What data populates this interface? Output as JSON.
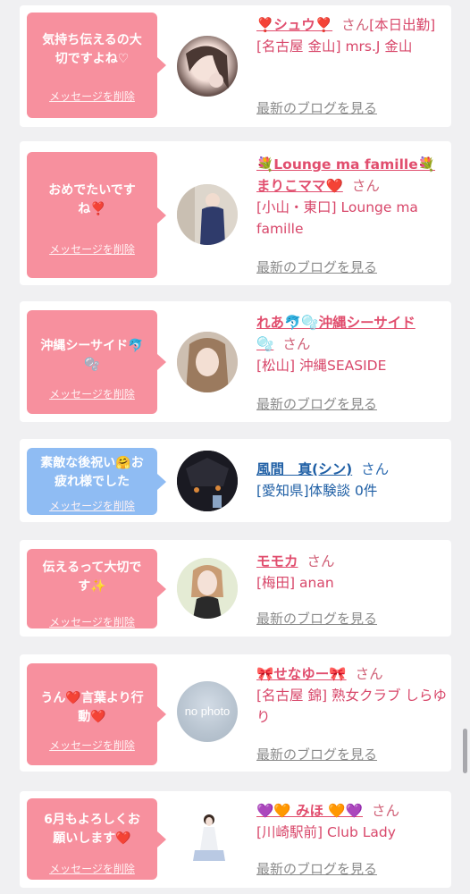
{
  "delete_label": "メッセージを削除",
  "blog_label": "最新のブログを見る",
  "honorific": "さん",
  "cards": [
    {
      "message": "気持ち伝えるの大\n切ですよね♡",
      "name": "❣️シュウ❣️",
      "name_tail": "",
      "badge": "[本日出勤]",
      "tag": "[名古屋 金山] mrs.J 金山"
    },
    {
      "message": "おめでたいです\nね❣️",
      "name": "💐Lounge ma famille💐",
      "name_tail": "まりこママ❤️",
      "tag": "[小山・東口] Lounge ma famille"
    },
    {
      "message": "沖縄シーサイド🐬\n🫧",
      "name": "れあ🐬🫧沖縄シーサイド",
      "name_tail": "🫧",
      "tag": "[松山] 沖縄SEASIDE"
    },
    {
      "message": "素敵な後祝い🤗お\n疲れ様でした",
      "name": "風間　真(シン)",
      "tag": "[愛知県]体験談 0件"
    },
    {
      "message": "伝えるって大切で\nす✨",
      "name": "モモカ",
      "tag": "[梅田] anan"
    },
    {
      "message": "うん❤️言葉より行\n動❤️",
      "name": "🎀せなゆー🎀",
      "tag": "[名古屋 錦] 熟女クラブ しらゆり",
      "avatar_text": "no photo"
    },
    {
      "message": "6月もよろしくお\n願いします❤️",
      "name": "💜🧡 みほ 🧡💜",
      "tag": "[川崎駅前] Club Lady"
    }
  ]
}
